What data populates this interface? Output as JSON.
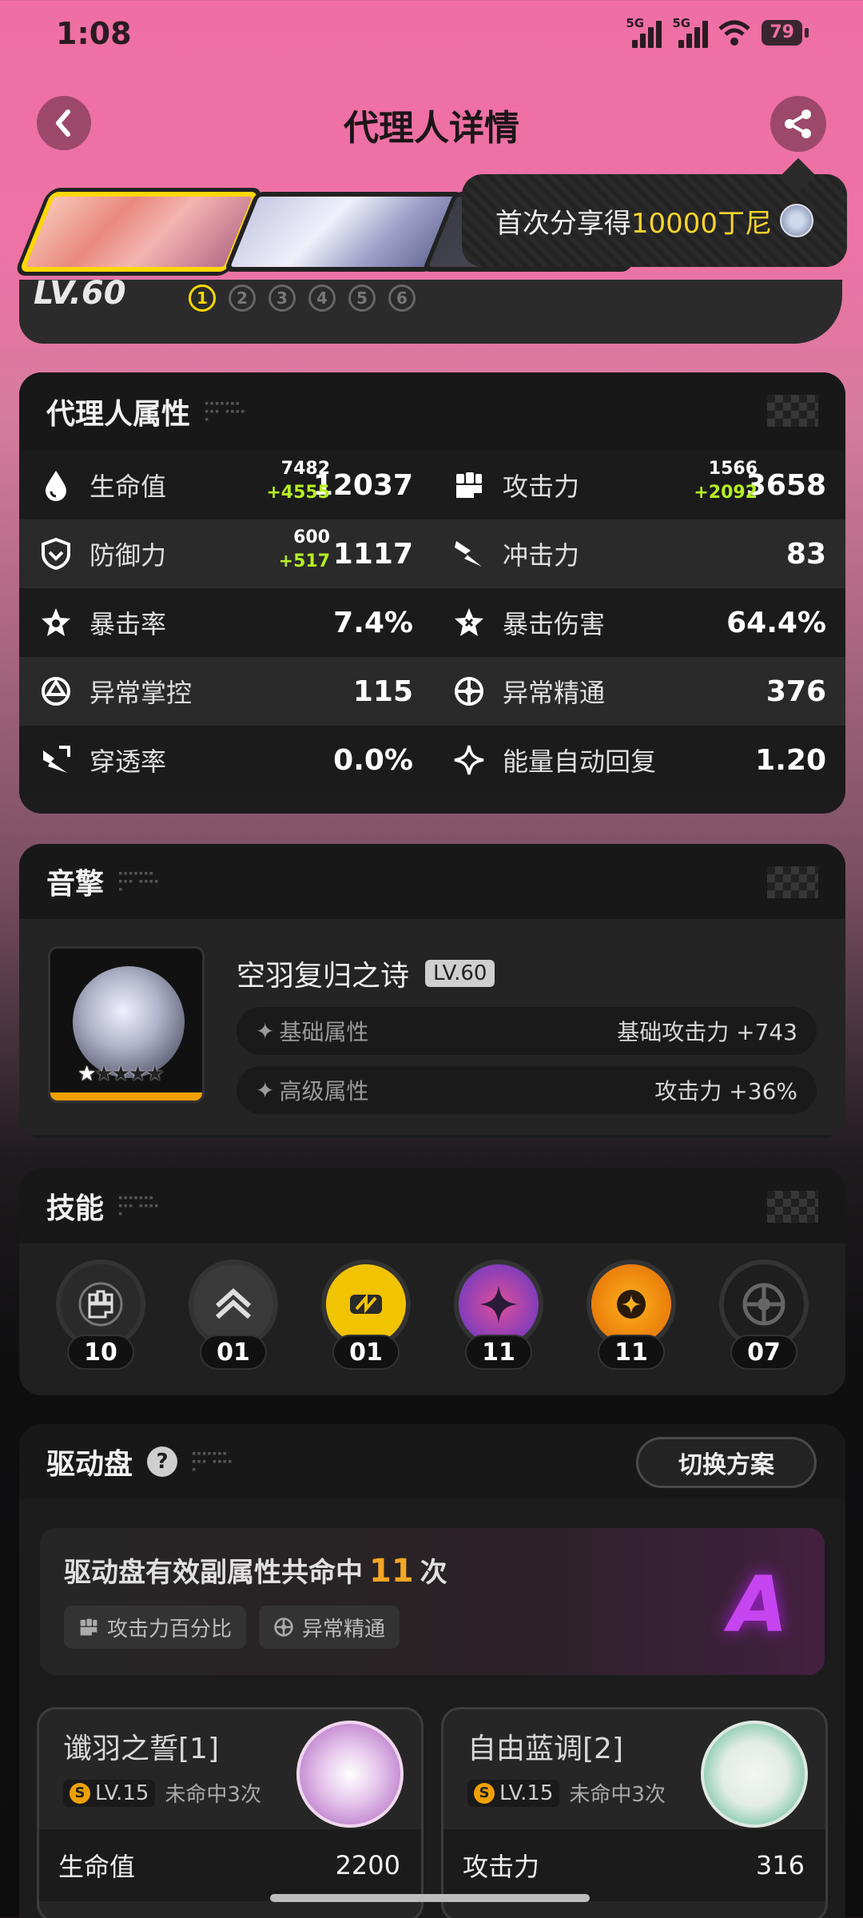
{
  "status_bar": {
    "time": "1:08",
    "signal1": "5G",
    "signal2": "5G",
    "battery": "79"
  },
  "header": {
    "title": "代理人详情"
  },
  "share_tooltip": {
    "prefix": "首次分享得",
    "amount": "10000丁尼"
  },
  "agent": {
    "level": "LV.60",
    "mindscape": [
      "1",
      "2",
      "3",
      "4",
      "5",
      "6"
    ],
    "mindscape_active": 1
  },
  "attributes": {
    "title": "代理人属性",
    "rows": [
      {
        "left": {
          "label": "生命值",
          "base": "7482",
          "bonus": "+4555",
          "value": "12037"
        },
        "right": {
          "label": "攻击力",
          "base": "1566",
          "bonus": "+2092",
          "value": "3658"
        }
      },
      {
        "left": {
          "label": "防御力",
          "base": "600",
          "bonus": "+517",
          "value": "1117"
        },
        "right": {
          "label": "冲击力",
          "value": "83"
        }
      },
      {
        "left": {
          "label": "暴击率",
          "value": "7.4%"
        },
        "right": {
          "label": "暴击伤害",
          "value": "64.4%"
        }
      },
      {
        "left": {
          "label": "异常掌控",
          "value": "115"
        },
        "right": {
          "label": "异常精通",
          "value": "376"
        }
      },
      {
        "left": {
          "label": "穿透率",
          "value": "0.0%"
        },
        "right": {
          "label": "能量自动回复",
          "value": "1.20"
        }
      }
    ]
  },
  "engine": {
    "title": "音擎",
    "name": "空羽复归之诗",
    "level": "LV.60",
    "base_label": "基础属性",
    "base_value": "基础攻击力 +743",
    "adv_label": "高级属性",
    "adv_value": "攻击力 +36%"
  },
  "skills": {
    "title": "技能",
    "items": [
      {
        "icon": "fist-icon",
        "level": "10"
      },
      {
        "icon": "chevron-up-icon",
        "level": "01"
      },
      {
        "icon": "swap-icon",
        "level": "01"
      },
      {
        "icon": "star-burst-icon",
        "level": "11"
      },
      {
        "icon": "ultimate-icon",
        "level": "11"
      },
      {
        "icon": "core-wheel-icon",
        "level": "07"
      }
    ]
  },
  "drive_disc": {
    "title": "驱动盘",
    "switch_label": "切换方案",
    "hits_prefix": "驱动盘有效副属性共命中",
    "hits_count": "11",
    "hits_suffix": "次",
    "chips": [
      "攻击力百分比",
      "异常精通"
    ],
    "grade": "A",
    "discs": [
      {
        "name": "谶羽之誓[1]",
        "level": "LV.15",
        "miss": "未命中3次",
        "main_stat": "生命值",
        "main_value": "2200"
      },
      {
        "name": "自由蓝调[2]",
        "level": "LV.15",
        "miss": "未命中3次",
        "main_stat": "攻击力",
        "main_value": "316"
      }
    ]
  },
  "colors": {
    "accent_pink": "#ef6fa4",
    "bonus_green": "#b6f020",
    "gold": "#ffd800",
    "hits_orange": "#f5a623",
    "grade_purple": "#c545f0"
  }
}
